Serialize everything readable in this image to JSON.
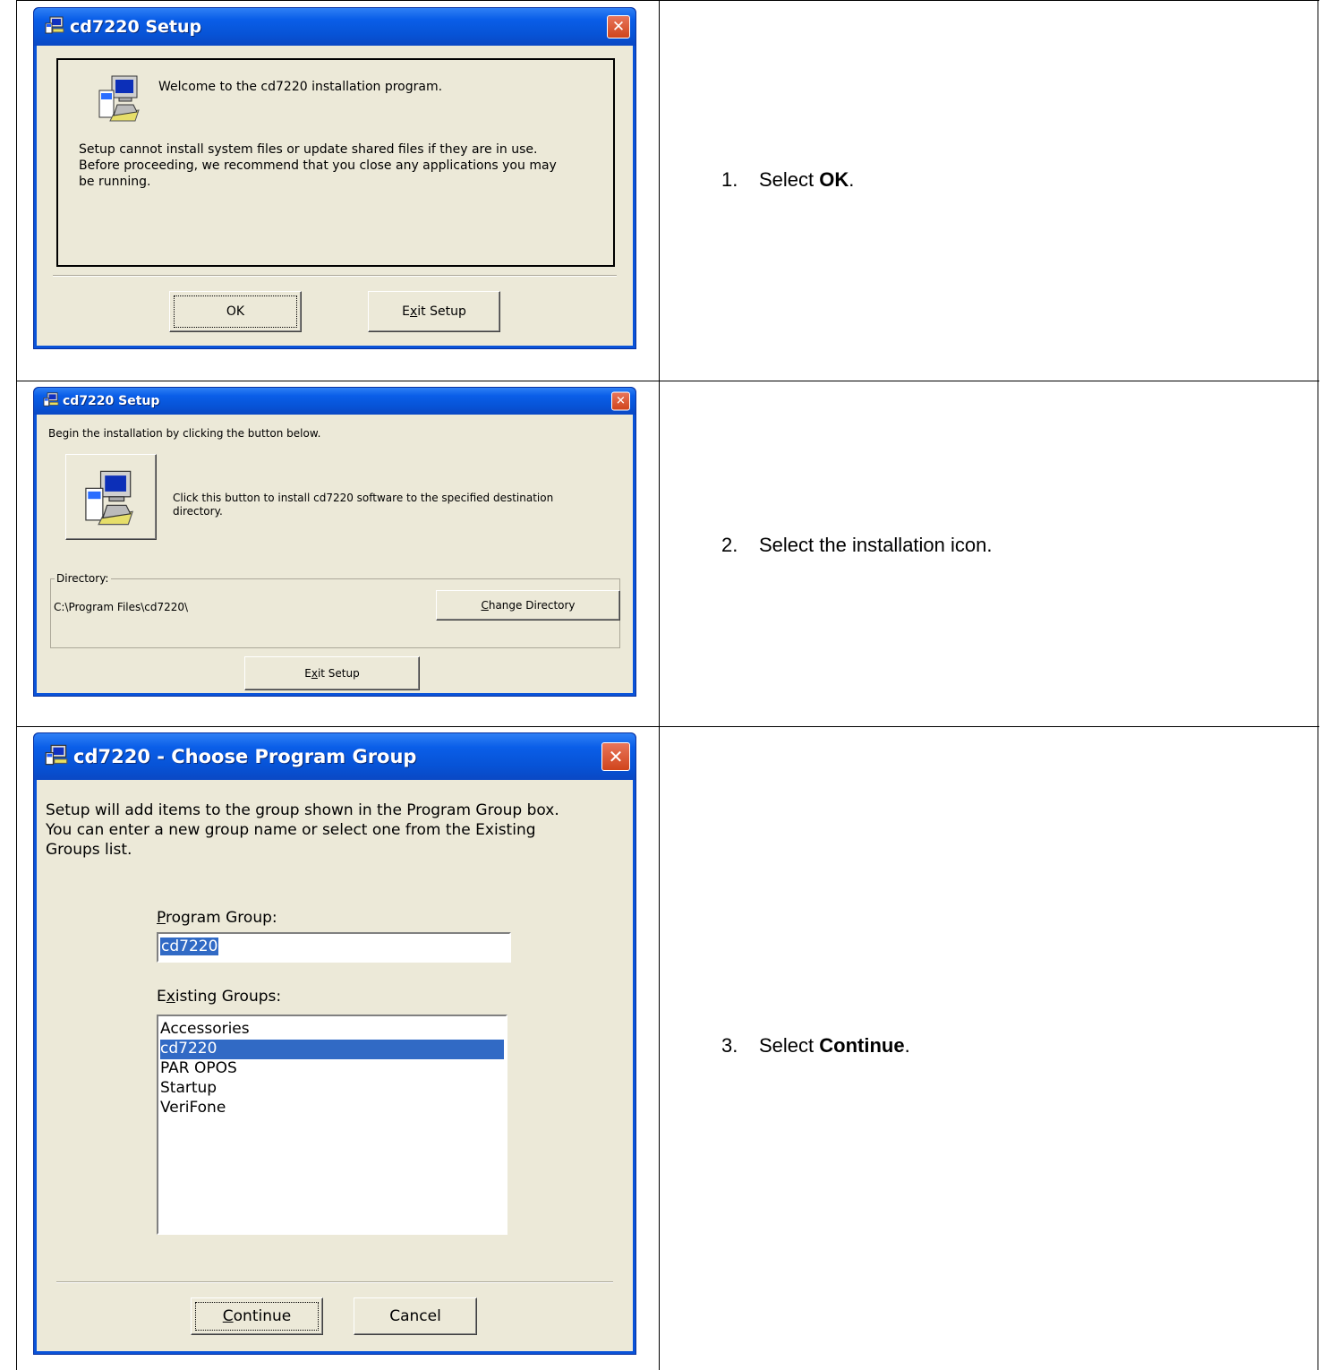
{
  "steps": [
    {
      "number": "1.",
      "prefix": "Select ",
      "bold": "OK",
      "suffix": "."
    },
    {
      "number": "2.",
      "prefix": "Select the installation icon.",
      "bold": "",
      "suffix": ""
    },
    {
      "number": "3.",
      "prefix": "Select ",
      "bold": "Continue",
      "suffix": "."
    }
  ],
  "dialog1": {
    "title": "cd7220 Setup",
    "welcome": "Welcome to the cd7220 installation program.",
    "body": [
      "Setup cannot install system files or update shared files if they are in use.",
      "Before proceeding, we recommend that you close any applications you may",
      "be running."
    ],
    "ok_label": "OK",
    "exit_pre": "E",
    "exit_ul": "x",
    "exit_post": "it Setup"
  },
  "dialog2": {
    "title": "cd7220 Setup",
    "begin": "Begin the installation by clicking the button below.",
    "install_desc": [
      "Click this button to install cd7220 software to the specified destination",
      "directory."
    ],
    "directory_legend": "Directory:",
    "directory_path": "C:\\Program Files\\cd7220\\",
    "change_ul": "C",
    "change_post": "hange Directory",
    "exit_pre": "E",
    "exit_ul": "x",
    "exit_post": "it Setup"
  },
  "dialog3": {
    "title": "cd7220 - Choose Program Group",
    "body": [
      "Setup will add items to the group shown in the Program Group box.",
      "You can enter a new group name or select one from the Existing",
      "Groups list."
    ],
    "program_group_ul": "P",
    "program_group_post": "rogram Group:",
    "program_group_value": "cd7220",
    "existing_pre": "E",
    "existing_ul": "x",
    "existing_post": "isting Groups:",
    "groups": [
      "Accessories",
      "cd7220",
      "PAR OPOS",
      "Startup",
      "VeriFone"
    ],
    "selected_group": "cd7220",
    "continue_ul": "C",
    "continue_post": "ontinue",
    "cancel_label": "Cancel"
  },
  "colors": {
    "titlebar": "#0a5ee8",
    "close": "#d0451c",
    "face": "#ece9d8",
    "selection": "#316ac5"
  }
}
